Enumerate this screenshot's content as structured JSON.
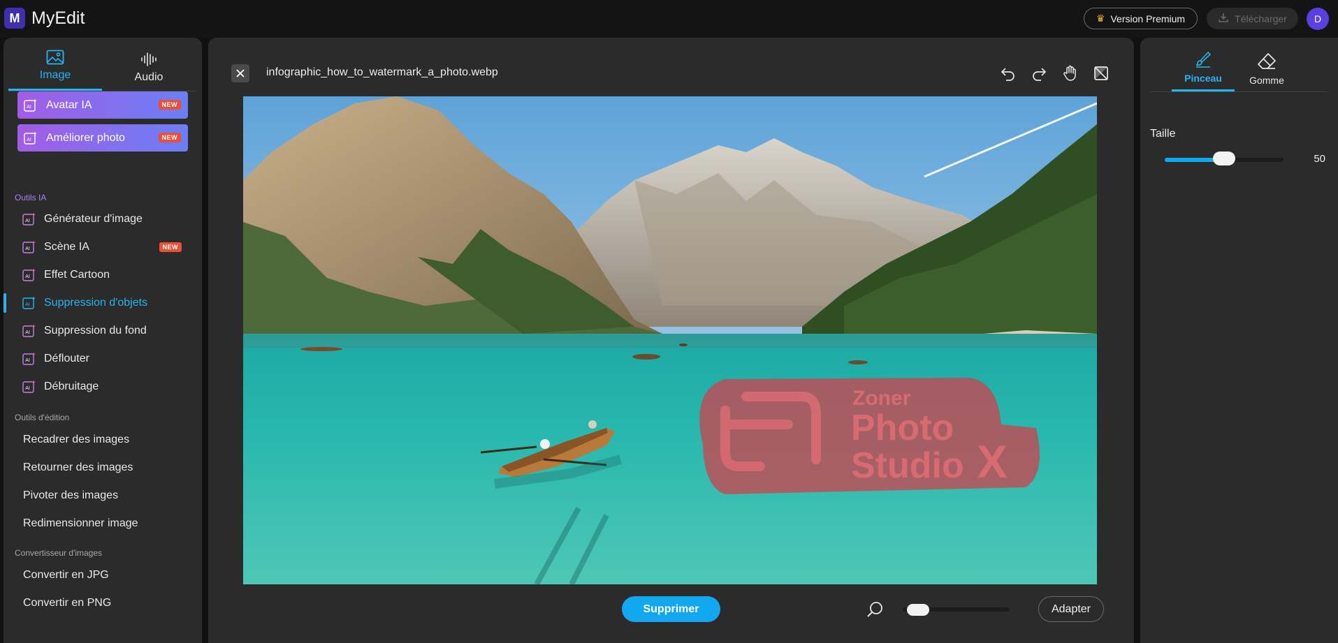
{
  "app": {
    "title": "MyEdit",
    "logo_letter": "M"
  },
  "header": {
    "premium_label": "Version Premium",
    "download_label": "Télécharger",
    "avatar_initial": "D"
  },
  "sidebar": {
    "tabs": [
      {
        "label": "Image",
        "icon": "image-icon",
        "active": true
      },
      {
        "label": "Audio",
        "icon": "audio-wave-icon",
        "active": false
      }
    ],
    "promos": [
      {
        "label": "Avatar IA",
        "badge": "NEW"
      },
      {
        "label": "Améliorer photo",
        "badge": "NEW"
      }
    ],
    "sections": [
      {
        "title": "Outils IA",
        "items": [
          {
            "label": "Générateur d'image",
            "badge": ""
          },
          {
            "label": "Scène IA",
            "badge": "NEW"
          },
          {
            "label": "Effet Cartoon",
            "badge": ""
          },
          {
            "label": "Suppression d'objets",
            "badge": "",
            "active": true
          },
          {
            "label": "Suppression du fond",
            "badge": ""
          },
          {
            "label": "Déflouter",
            "badge": ""
          },
          {
            "label": "Débruitage",
            "badge": ""
          }
        ]
      },
      {
        "title": "Outils d'édition",
        "items": [
          {
            "label": "Recadrer des images"
          },
          {
            "label": "Retourner des images"
          },
          {
            "label": "Pivoter des images"
          },
          {
            "label": "Redimensionner image"
          }
        ]
      },
      {
        "title": "Convertisseur d'images",
        "items": [
          {
            "label": "Convertir en JPG"
          },
          {
            "label": "Convertir en PNG"
          }
        ]
      }
    ]
  },
  "editor": {
    "file_name": "infographic_how_to_watermark_a_photo.webp",
    "toolbar_icons": [
      "undo-icon",
      "redo-icon",
      "hand-pan-icon",
      "compare-icon"
    ],
    "image_watermark": {
      "line1": "Zoner",
      "line2": "Photo",
      "line3": "Studio",
      "suffix": "X"
    },
    "delete_label": "Supprimer",
    "zoom_level": 0.05,
    "fit_label": "Adapter"
  },
  "brush_panel": {
    "tabs": [
      {
        "label": "Pinceau",
        "icon": "brush-icon",
        "active": true
      },
      {
        "label": "Gomme",
        "icon": "eraser-icon",
        "active": false
      }
    ],
    "size_label": "Taille",
    "size_value": "50",
    "size_fraction": 0.5
  },
  "colors": {
    "accent": "#27b4f0",
    "button": "#12a8ef",
    "badge": "#e9503a",
    "watermark": "#c8454f"
  }
}
